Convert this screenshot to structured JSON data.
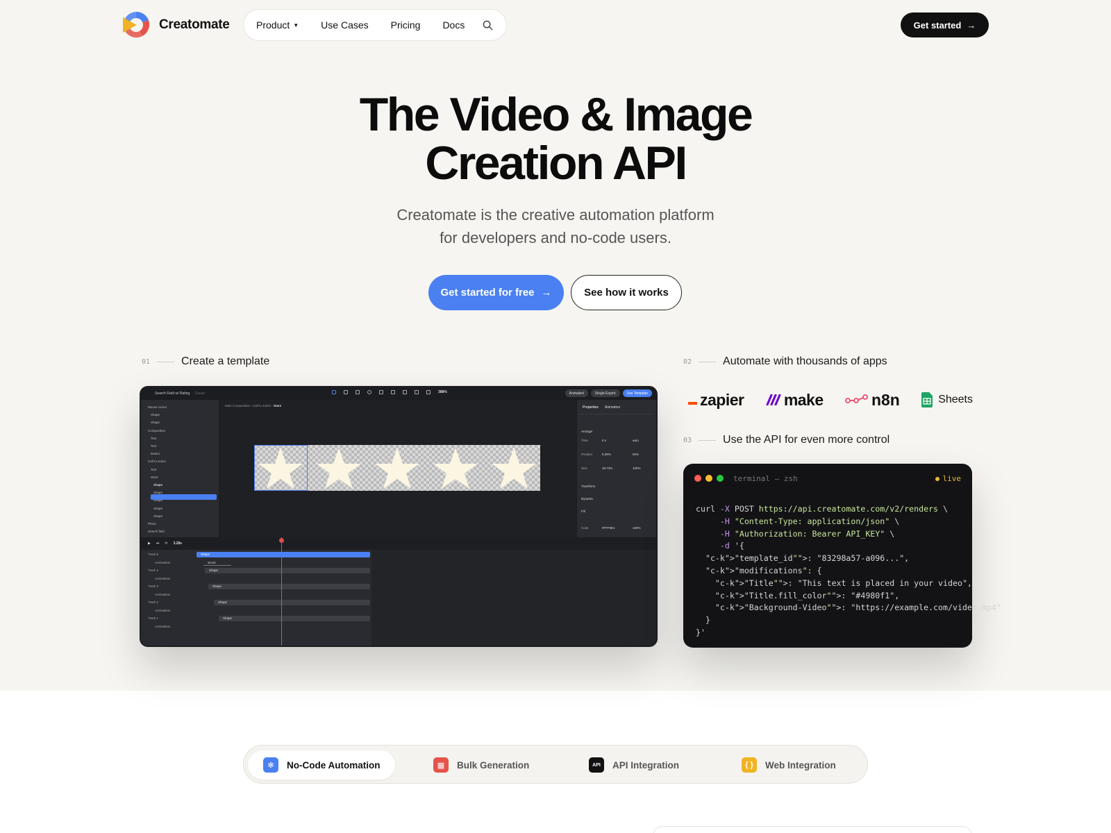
{
  "brand": {
    "name": "Creatomate"
  },
  "nav": {
    "items": [
      {
        "label": "Product",
        "has_dropdown": true
      },
      {
        "label": "Use Cases"
      },
      {
        "label": "Pricing"
      },
      {
        "label": "Docs"
      }
    ],
    "search_icon": "search-icon",
    "cta_label": "Get started",
    "cta_icon": "→"
  },
  "hero": {
    "title_line1": "The Video & Image",
    "title_line2": "Creation API",
    "subtitle_line1": "Creatomate is the creative automation platform",
    "subtitle_line2": "for developers and no-code users.",
    "primary_cta": "Get started for free",
    "primary_cta_icon": "→",
    "secondary_cta": "See how it works"
  },
  "steps": [
    {
      "num": "01",
      "label": "Create a template"
    },
    {
      "num": "02",
      "label": "Automate with thousands of apps"
    },
    {
      "num": "03",
      "label": "Use the API for even more control"
    }
  ],
  "editor": {
    "doc_title": "Search Field w/ Rating",
    "doc_status": "Saved",
    "toggle_label": "Animated",
    "export_label": "Single Export",
    "use_template_label": "Use Template",
    "zoom": "388%",
    "breadcrumb": [
      "Main Composition",
      "Call to action",
      "Stars"
    ],
    "layers": [
      "Mouse cursor",
      "Shape",
      "Shape",
      "Composition",
      "Text",
      "Text",
      "Button",
      "Call to action",
      "Text",
      "Stars",
      "Shape",
      "Shape",
      "Shape",
      "Shape",
      "Shape",
      "Photo",
      "Search field"
    ],
    "panel_tabs": [
      "Properties",
      "Animation"
    ],
    "panel_sections": [
      "Arrange",
      "Transform",
      "Dynamic",
      "Fill"
    ],
    "panel_rows": [
      {
        "label": "Time",
        "a": "0 s",
        "b": "auto"
      },
      {
        "label": "Position",
        "a": "8.38%",
        "b": "50%"
      },
      {
        "label": "Size",
        "a": "18.73%",
        "b": "100%"
      },
      {
        "label": "Color",
        "a": "#FFF6E1",
        "b": "100%"
      }
    ],
    "timecode": "3.28s",
    "tracks": [
      {
        "name": "Track 5",
        "bar": "Shape"
      },
      {
        "name": "Animations",
        "bar": "Score"
      },
      {
        "name": "Track 4",
        "bar": "Shape"
      },
      {
        "name": "Animations",
        "bar": ""
      },
      {
        "name": "Track 3",
        "bar": "Shape"
      },
      {
        "name": "Animations",
        "bar": ""
      },
      {
        "name": "Track 2",
        "bar": "Shape"
      },
      {
        "name": "Animations",
        "bar": ""
      },
      {
        "name": "Track 1",
        "bar": "Shape"
      },
      {
        "name": "Animations",
        "bar": ""
      }
    ]
  },
  "apps": [
    {
      "name": "zapier",
      "icon": "zapier-icon"
    },
    {
      "name": "make",
      "icon": "make-icon"
    },
    {
      "name": "n8n",
      "icon": "n8n-icon"
    },
    {
      "name": "Sheets",
      "icon": "sheets-icon"
    }
  ],
  "terminal": {
    "title": "terminal — zsh",
    "status": "live",
    "lines": [
      "curl -X POST https://api.creatomate.com/v2/renders \\",
      "     -H \"Content-Type: application/json\" \\",
      "     -H \"Authorization: Bearer API_KEY\" \\",
      "     -d '{",
      "  \"template_id\": \"83298a57-a096...\",",
      "  \"modifications\": {",
      "    \"Title\": \"This text is placed in your video\",",
      "    \"Title.fill_color\": \"#4980f1\",",
      "    \"Background-Video\": \"https://example.com/video.mp4\"",
      "  }",
      "}'"
    ]
  },
  "tabs": [
    {
      "label": "No-Code Automation",
      "icon": "gear-icon",
      "color": "#4a80f1",
      "active": true
    },
    {
      "label": "Bulk Generation",
      "icon": "table-icon",
      "color": "#e5534b",
      "active": false
    },
    {
      "label": "API Integration",
      "icon": "api-icon",
      "color": "#111111",
      "active": false
    },
    {
      "label": "Web Integration",
      "icon": "braces-icon",
      "color": "#f0b323",
      "active": false
    }
  ],
  "colors": {
    "accent": "#4a80f1",
    "hero_bg": "#f6f5f1",
    "dark": "#111111"
  }
}
